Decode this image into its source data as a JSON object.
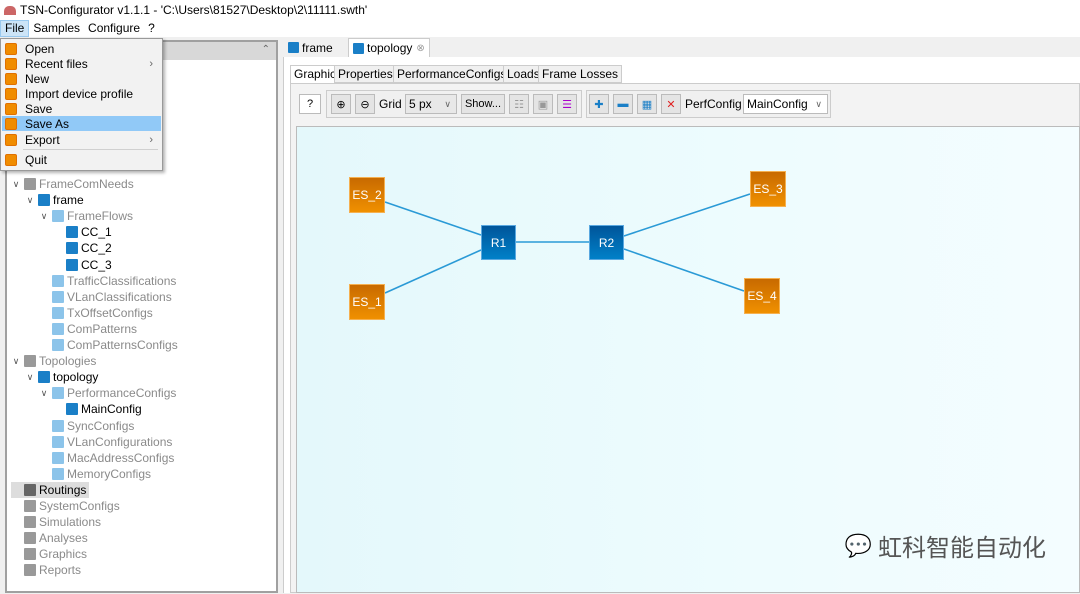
{
  "window": {
    "title": "TSN-Configurator v1.1.1 - 'C:\\Users\\81527\\Desktop\\2\\11111.swth'"
  },
  "menubar": [
    "File",
    "Samples",
    "Configure",
    "?"
  ],
  "file_menu": {
    "items": [
      {
        "label": "Open",
        "submenu": false
      },
      {
        "label": "Recent files",
        "submenu": true
      },
      {
        "label": "New",
        "submenu": false
      },
      {
        "label": "Import device profile",
        "submenu": false
      },
      {
        "label": "Save",
        "submenu": false
      },
      {
        "label": "Save As",
        "submenu": false,
        "highlighted": true
      },
      {
        "label": "Export",
        "submenu": true
      },
      {
        "label": "Quit",
        "submenu": false
      }
    ]
  },
  "tree": [
    {
      "label": "FrameComNeeds",
      "level": 0,
      "expanded": true,
      "style": "grey",
      "icon": "frame-com-needs-icon"
    },
    {
      "label": "frame",
      "level": 1,
      "expanded": true,
      "style": "normal",
      "icon": "frame-icon"
    },
    {
      "label": "FrameFlows",
      "level": 2,
      "expanded": true,
      "style": "grey",
      "icon": "frame-flows-icon"
    },
    {
      "label": "CC_1",
      "level": 3,
      "style": "normal",
      "icon": "flow-icon"
    },
    {
      "label": "CC_2",
      "level": 3,
      "style": "normal",
      "icon": "flow-icon"
    },
    {
      "label": "CC_3",
      "level": 3,
      "style": "normal",
      "icon": "flow-icon"
    },
    {
      "label": "TrafficClassifications",
      "level": 2,
      "style": "grey",
      "icon": "list-icon"
    },
    {
      "label": "VLanClassifications",
      "level": 2,
      "style": "grey",
      "icon": "vlan-icon"
    },
    {
      "label": "TxOffsetConfigs",
      "level": 2,
      "style": "grey",
      "icon": "offset-icon"
    },
    {
      "label": "ComPatterns",
      "level": 2,
      "style": "grey",
      "icon": "pattern-icon"
    },
    {
      "label": "ComPatternsConfigs",
      "level": 2,
      "style": "grey",
      "icon": "pattern-config-icon"
    },
    {
      "label": "Topologies",
      "level": 0,
      "expanded": true,
      "style": "grey",
      "icon": "topologies-icon"
    },
    {
      "label": "topology",
      "level": 1,
      "expanded": true,
      "style": "normal",
      "icon": "topology-icon"
    },
    {
      "label": "PerformanceConfigs",
      "level": 2,
      "expanded": true,
      "style": "grey",
      "icon": "performance-icon"
    },
    {
      "label": "MainConfig",
      "level": 3,
      "style": "normal",
      "icon": "performance-icon"
    },
    {
      "label": "SyncConfigs",
      "level": 2,
      "style": "grey",
      "icon": "sync-icon"
    },
    {
      "label": "VLanConfigurations",
      "level": 2,
      "style": "grey",
      "icon": "vlan-icon"
    },
    {
      "label": "MacAddressConfigs",
      "level": 2,
      "style": "grey",
      "icon": "mac-icon"
    },
    {
      "label": "MemoryConfigs",
      "level": 2,
      "style": "grey",
      "icon": "memory-icon"
    },
    {
      "label": "Routings",
      "level": 0,
      "style": "selected",
      "icon": "routing-icon"
    },
    {
      "label": "SystemConfigs",
      "level": 0,
      "style": "grey",
      "icon": "system-icon"
    },
    {
      "label": "Simulations",
      "level": 0,
      "style": "grey",
      "icon": "simulation-icon"
    },
    {
      "label": "Analyses",
      "level": 0,
      "style": "grey",
      "icon": "analysis-icon"
    },
    {
      "label": "Graphics",
      "level": 0,
      "style": "grey",
      "icon": "graphics-icon"
    },
    {
      "label": "Reports",
      "level": 0,
      "style": "grey",
      "icon": "reports-icon"
    }
  ],
  "editor_tabs": [
    {
      "label": "frame",
      "active": false
    },
    {
      "label": "topology",
      "active": true
    }
  ],
  "inner_tabs": [
    "Graphic",
    "Properties",
    "PerformanceConfigs",
    "Loads",
    "Frame Losses"
  ],
  "toolbar": {
    "help": "?",
    "grid_label": "Grid",
    "grid_value": "5 px",
    "show_label": "Show...",
    "perfconfig_label": "PerfConfig",
    "perfconfig_value": "MainConfig"
  },
  "topology": {
    "nodes": [
      {
        "id": "ES_2",
        "type": "end-station"
      },
      {
        "id": "ES_1",
        "type": "end-station"
      },
      {
        "id": "R1",
        "type": "router"
      },
      {
        "id": "R2",
        "type": "router"
      },
      {
        "id": "ES_3",
        "type": "end-station"
      },
      {
        "id": "ES_4",
        "type": "end-station"
      }
    ],
    "links": [
      [
        "ES_2",
        "R1"
      ],
      [
        "ES_1",
        "R1"
      ],
      [
        "R1",
        "R2"
      ],
      [
        "R2",
        "ES_3"
      ],
      [
        "R2",
        "ES_4"
      ]
    ],
    "colors": {
      "end_station": "#e07f00",
      "router": "#0068ad",
      "link": "#2a9ad6",
      "canvas": "#e8fbfd"
    }
  },
  "watermark": "虹科智能自动化"
}
